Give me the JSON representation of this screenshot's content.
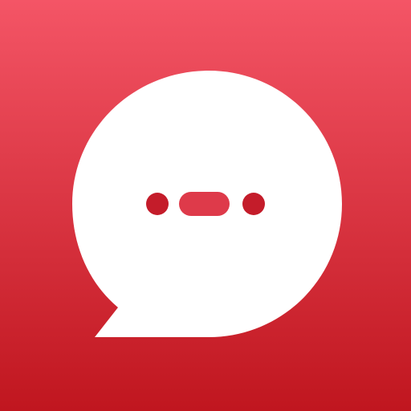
{
  "icon": {
    "name": "chat-bubble-app-icon",
    "glyph": "speech-bubble-with-typing-dots",
    "colors": {
      "background_top": "#f45566",
      "background_bottom": "#c0161f",
      "bubble": "#ffffff",
      "dots": "#c41c2a",
      "dash": "#de3a4a"
    }
  }
}
